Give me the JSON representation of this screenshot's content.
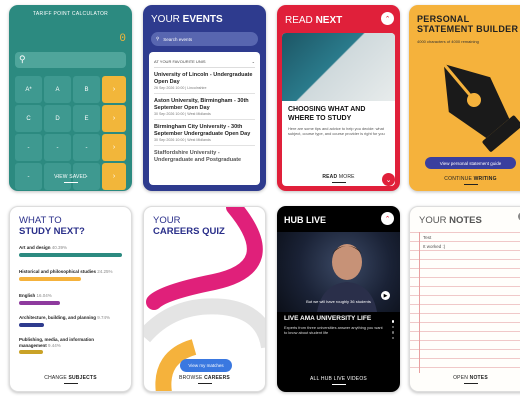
{
  "tariff": {
    "title": "TARIFF POINT CALCULATOR",
    "display_value": "0",
    "keys": [
      "A*",
      "A",
      "B",
      "C",
      "D",
      "E",
      "-",
      "-",
      "-",
      "-",
      "-",
      "-"
    ],
    "footer": "VIEW SAVED"
  },
  "events": {
    "title_light": "YOUR ",
    "title_bold": "EVENTS",
    "search_placeholder": "Search events",
    "filter_label": "AT YOUR FAVOURITE UNIS",
    "items": [
      {
        "name": "University of Lincoln - Undergraduate Open Day",
        "detail": "26 Sep 2026 10:00 | Lincolnshire"
      },
      {
        "name": "Aston University, Birmingham - 30th September Open Day",
        "detail": "30 Sep 2026 10:00 | West Midlands"
      },
      {
        "name": "Birmingham City University - 30th September Undergraduate Open Day",
        "detail": "30 Sep 2026 10:00 | West Midlands"
      },
      {
        "name": "Staffordshire University - Undergraduate and Postgraduate",
        "detail": ""
      }
    ]
  },
  "readnext": {
    "title_light": "READ ",
    "title_bold": "NEXT",
    "heading": "CHOOSING WHAT AND WHERE TO STUDY",
    "body": "Here are some tips and advice to help you decide: what subject, course type, and course provider is right for you",
    "footer_bold": "READ",
    "footer_rest": " MORE"
  },
  "statement": {
    "title_line1": "PERSONAL",
    "title_line2": "STATEMENT BUILDER",
    "subtitle": "4000 characters of 4000 remaining",
    "button": "View personal statement guide",
    "footer_light": "CONTINUE ",
    "footer_bold": "WRITING"
  },
  "study": {
    "title_line1": "WHAT TO",
    "title_line2": "STUDY NEXT?",
    "subjects": [
      {
        "name": "Art and design",
        "pct": "40.39%",
        "value": 40.39,
        "color": "#2c8a80"
      },
      {
        "name": "Historical and philosophical studies",
        "pct": "24.25%",
        "value": 24.25,
        "color": "#f5b23c"
      },
      {
        "name": "English",
        "pct": "16.04%",
        "value": 16.04,
        "color": "#8e3a9e"
      },
      {
        "name": "Architecture, building, and planning",
        "pct": "9.74%",
        "value": 9.74,
        "color": "#2e3b8e"
      },
      {
        "name": "Publishing, media, and information management",
        "pct": "9.44%",
        "value": 9.44,
        "color": "#c9a227"
      }
    ],
    "footer_light": "CHANGE ",
    "footer_bold": "SUBJECTS"
  },
  "quiz": {
    "title_line1": "YOUR",
    "title_line2": "CAREERS QUIZ",
    "button": "View my matches",
    "footer_light": "BROWSE ",
    "footer_bold": "CAREERS"
  },
  "hub": {
    "title": "HUB LIVE",
    "caption": "But we will have roughly 36 students",
    "heading": "LIVE AMA UNIVERSITY LIFE",
    "body": "Experts from three universities answer anything you want to know about student life",
    "footer": "ALL HUB LIVE VIDEOS"
  },
  "notes": {
    "title_light": "YOUR ",
    "title_bold": "NOTES",
    "lines": [
      "Test",
      "It worked :)"
    ],
    "footer_light": "OPEN ",
    "footer_bold": "NOTES"
  }
}
